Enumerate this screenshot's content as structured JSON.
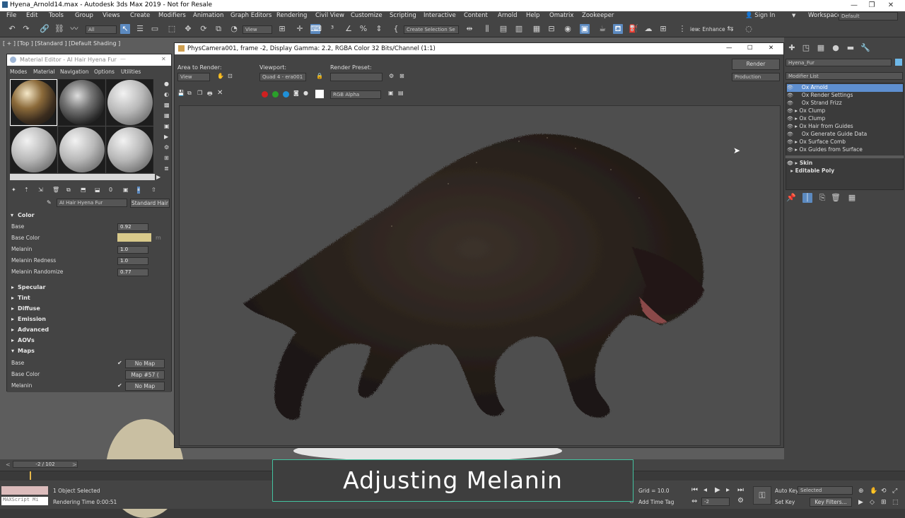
{
  "window": {
    "title": "Hyena_Arnold14.max - Autodesk 3ds Max 2019 - Not for Resale"
  },
  "menu": [
    "File",
    "Edit",
    "Tools",
    "Group",
    "Views",
    "Create",
    "Modifiers",
    "Animation",
    "Graph Editors",
    "Rendering",
    "Civil View",
    "Customize",
    "Scripting",
    "Interactive",
    "Content",
    "Arnold",
    "Help",
    "Omatrix",
    "Zookeeper"
  ],
  "account": {
    "sign_in": "Sign In",
    "workspaces_label": "Workspaces:",
    "workspace": "Default"
  },
  "toolbar": {
    "selection_filter": "All",
    "ref_coord": "View",
    "named_sel": "Create Selection Se",
    "viewport_label": "iew: Enhance"
  },
  "viewport": {
    "label": "[ + ] [Top ] [Standard ] [Default Shading ]"
  },
  "render_window": {
    "title": "PhysCamera001, frame -2, Display Gamma: 2.2, RGBA Color 32 Bits/Channel (1:1)",
    "area_label": "Area to Render:",
    "area_value": "View",
    "viewport_label": "Viewport:",
    "viewport_value": "Quad 4 - era001",
    "preset_label": "Render Preset:",
    "preset_value": "",
    "render_button": "Render",
    "production": "Production",
    "channel": "RGB Alpha"
  },
  "material_editor": {
    "title": "Material Editor - AI Hair Hyena Fur",
    "menu": [
      "Modes",
      "Material",
      "Navigation",
      "Options",
      "Utilities"
    ],
    "material_name": "AI Hair Hyena Fur",
    "material_type": "Standard Hair",
    "color_section": "Color",
    "params": [
      {
        "label": "Base",
        "value": "0.92"
      },
      {
        "label": "Base Color",
        "value": ""
      },
      {
        "label": "Melanin",
        "value": "1.0"
      },
      {
        "label": "Melanin Redness",
        "value": "1.0"
      },
      {
        "label": "Melanin Randomize",
        "value": "0.77"
      }
    ],
    "base_color_hex": "#d8c98a",
    "sections": [
      "Specular",
      "Tint",
      "Diffuse",
      "Emission",
      "Advanced",
      "AOVs"
    ],
    "maps_section": "Maps",
    "maps": [
      {
        "label": "Base",
        "value": "No Map"
      },
      {
        "label": "Base Color",
        "value": "Map #57 ("
      },
      {
        "label": "Melanin",
        "value": "No Map"
      }
    ]
  },
  "modifier_panel": {
    "object_name": "Hyena_Fur",
    "list_label": "Modifier List",
    "modifiers": [
      "Ox Arnold",
      "Ox Render Settings",
      "Ox Strand Frizz",
      "Ox Clump",
      "Ox Clump",
      "Ox Hair from Guides",
      "Ox Generate Guide Data",
      "Ox Surface Comb",
      "Ox Guides from Surface"
    ],
    "base": [
      "Skin",
      "Editable Poly"
    ]
  },
  "timeline": {
    "frame": "-2 / 102"
  },
  "status": {
    "script": "MAXScript Mi",
    "selected": "1 Object Selected",
    "render_time": "Rendering Time  0:00:51",
    "grid": "Grid = 10.0",
    "add_time_tag": "Add Time Tag",
    "auto_key": "Auto Key",
    "set_key": "Set Key",
    "selected_dd": "Selected",
    "key_filters": "Key Filters...",
    "frame_field": "-2",
    "z_label": "Z:"
  },
  "caption": "Adjusting Melanin",
  "colors": {
    "accent": "#5e8fd0",
    "caption_border": "#43c3a0"
  }
}
